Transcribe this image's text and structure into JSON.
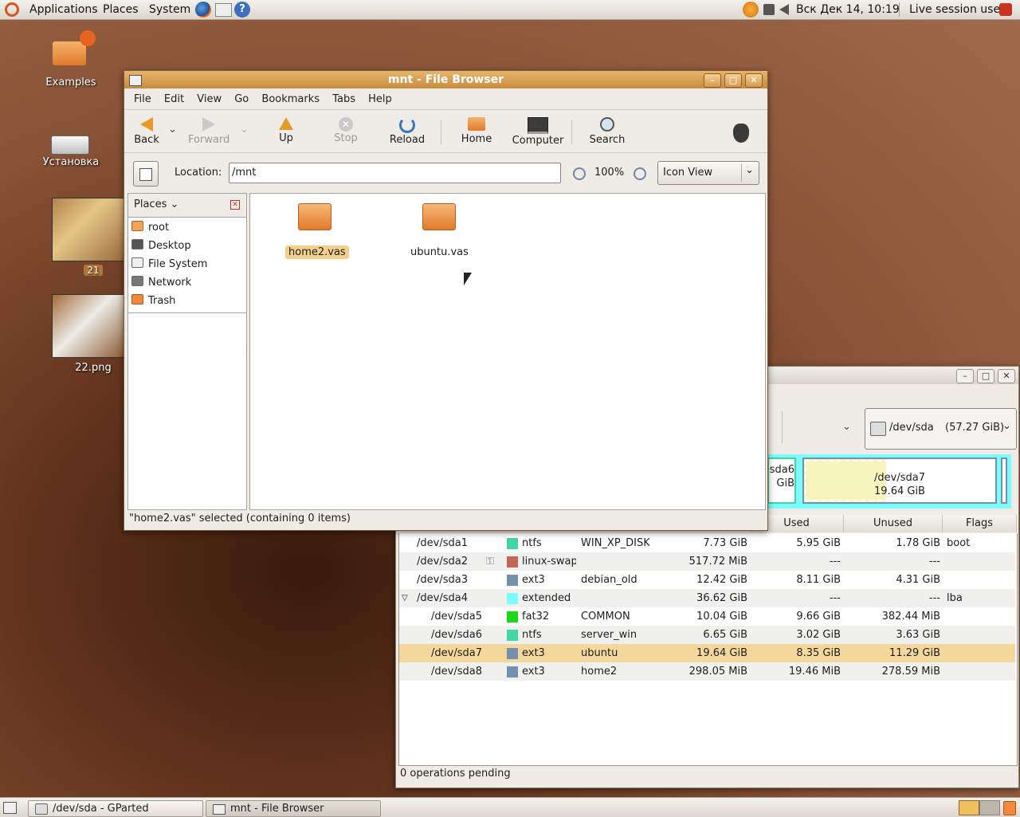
{
  "top_panel": {
    "menus": [
      "Applications",
      "Places",
      "System"
    ],
    "clock": "Вск Дек 14, 10:19",
    "user": "Live session user"
  },
  "desktop": {
    "icons": [
      {
        "label": "Examples"
      },
      {
        "label": "Установка"
      },
      {
        "label": "21"
      },
      {
        "label": "22.png"
      }
    ]
  },
  "file_browser": {
    "title": "mnt - File Browser",
    "menu": [
      "File",
      "Edit",
      "View",
      "Go",
      "Bookmarks",
      "Tabs",
      "Help"
    ],
    "toolbar": {
      "back": "Back",
      "forward": "Forward",
      "up": "Up",
      "stop": "Stop",
      "reload": "Reload",
      "home": "Home",
      "computer": "Computer",
      "search": "Search"
    },
    "location_label": "Location:",
    "location_value": "/mnt",
    "zoom": "100%",
    "view_mode": "Icon View",
    "sidebar_title": "Places",
    "places": [
      "root",
      "Desktop",
      "File System",
      "Network",
      "Trash"
    ],
    "files": [
      {
        "name": "home2.vas",
        "selected": true
      },
      {
        "name": "ubuntu.vas",
        "selected": false
      }
    ],
    "status": "\"home2.vas\" selected (containing 0 items)"
  },
  "gparted": {
    "device": "/dev/sda",
    "device_size": "(57.27 GiB)",
    "map": {
      "sda6_label_a": "sda6",
      "sda6_label_b": "GiB",
      "sda7_name": "/dev/sda7",
      "sda7_size": "19.64 GiB"
    },
    "columns": {
      "used": "Used",
      "unused": "Unused",
      "flags": "Flags"
    },
    "colors": {
      "ntfs": "#42d6a4",
      "linux-swap": "#c1665a",
      "ext3": "#7390ae",
      "extended": "#7dfcfe",
      "fat32": "#18d918"
    },
    "partitions": [
      {
        "partition": "/dev/sda1",
        "fs": "ntfs",
        "label": "WIN_XP_DISK",
        "size": "7.73 GiB",
        "used": "5.95 GiB",
        "unused": "1.78 GiB",
        "flags": "boot",
        "indent": false
      },
      {
        "partition": "/dev/sda2",
        "fs": "linux-swap",
        "label": "",
        "size": "517.72 MiB",
        "used": "---",
        "unused": "---",
        "flags": "",
        "indent": false
      },
      {
        "partition": "/dev/sda3",
        "fs": "ext3",
        "label": "debian_old",
        "size": "12.42 GiB",
        "used": "8.11 GiB",
        "unused": "4.31 GiB",
        "flags": "",
        "indent": false
      },
      {
        "partition": "/dev/sda4",
        "fs": "extended",
        "label": "",
        "size": "36.62 GiB",
        "used": "---",
        "unused": "---",
        "flags": "lba",
        "indent": false
      },
      {
        "partition": "/dev/sda5",
        "fs": "fat32",
        "label": "COMMON",
        "size": "10.04 GiB",
        "used": "9.66 GiB",
        "unused": "382.44 MiB",
        "flags": "",
        "indent": true
      },
      {
        "partition": "/dev/sda6",
        "fs": "ntfs",
        "label": "server_win",
        "size": "6.65 GiB",
        "used": "3.02 GiB",
        "unused": "3.63 GiB",
        "flags": "",
        "indent": true
      },
      {
        "partition": "/dev/sda7",
        "fs": "ext3",
        "label": "ubuntu",
        "size": "19.64 GiB",
        "used": "8.35 GiB",
        "unused": "11.29 GiB",
        "flags": "",
        "indent": true
      },
      {
        "partition": "/dev/sda8",
        "fs": "ext3",
        "label": "home2",
        "size": "298.05 MiB",
        "used": "19.46 MiB",
        "unused": "278.59 MiB",
        "flags": "",
        "indent": true
      }
    ],
    "selected_index": 6,
    "status": "0 operations pending"
  },
  "bottom_panel": {
    "tasks": [
      "/dev/sda - GParted",
      "mnt - File Browser"
    ]
  }
}
